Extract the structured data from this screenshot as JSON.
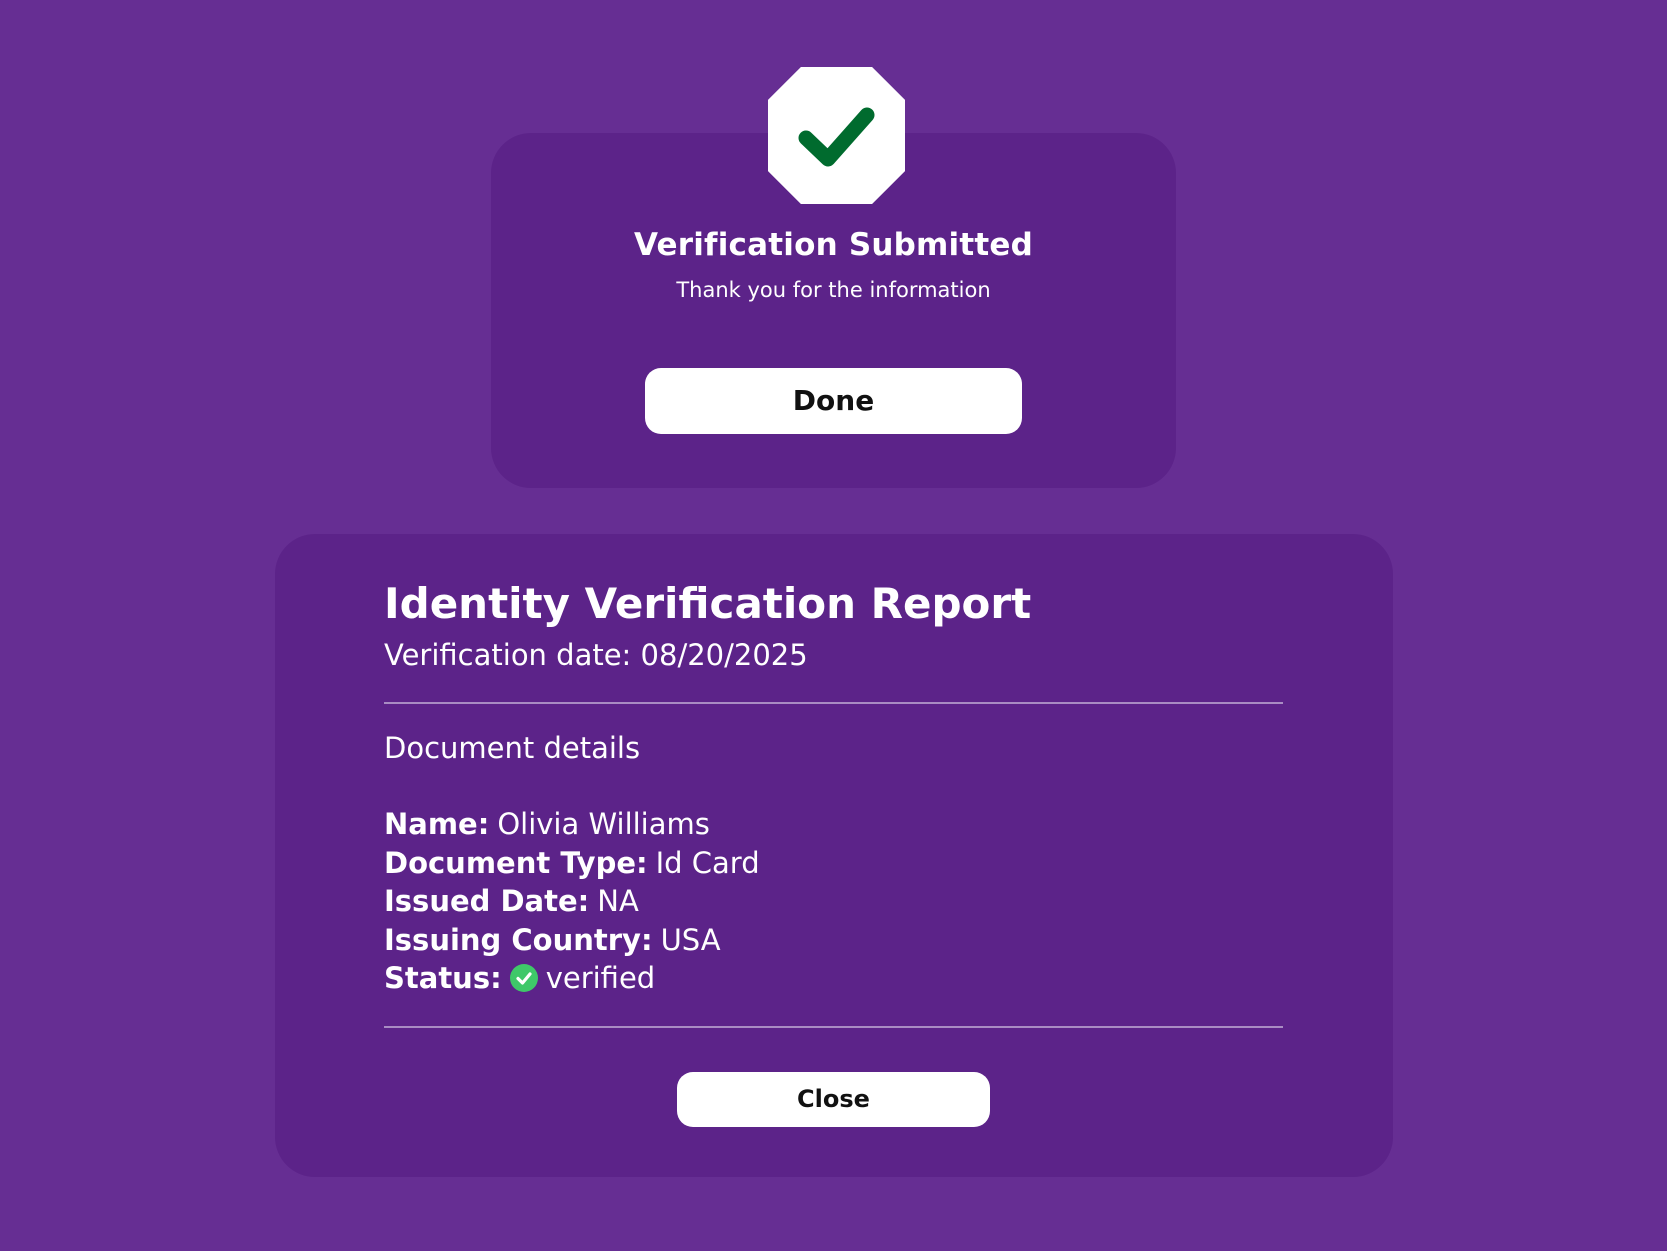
{
  "confirmation": {
    "icon": "check-octagon-icon",
    "icon_color": "#006b2e",
    "title": "Verification Submitted",
    "subtitle": "Thank you for the information",
    "done_label": "Done"
  },
  "report": {
    "title": "Identity Verification Report",
    "date_label": "Verification date:",
    "date_value": "08/20/2025",
    "section_heading": "Document details",
    "fields": [
      {
        "label": "Name:",
        "value": "Olivia Williams"
      },
      {
        "label": "Document Type:",
        "value": "Id Card"
      },
      {
        "label": "Issued Date:",
        "value": "NA"
      },
      {
        "label": "Issuing Country:",
        "value": "USA"
      }
    ],
    "status": {
      "label": "Status:",
      "icon": "check-circle-icon",
      "icon_color": "#3fc869",
      "value": "verified"
    },
    "close_label": "Close"
  },
  "colors": {
    "background": "#662e93",
    "card": "#5c2389",
    "button": "#ffffff",
    "divider": "#a98cc3"
  }
}
